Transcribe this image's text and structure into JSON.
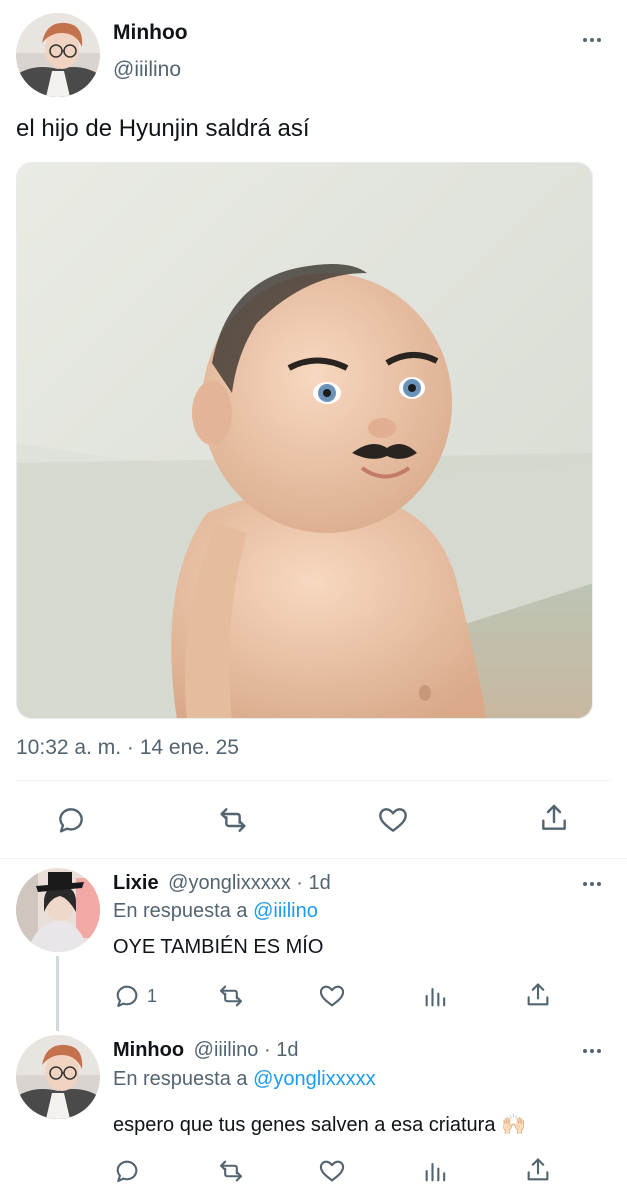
{
  "main_tweet": {
    "author_name": "Minhoo",
    "author_handle": "@iiilino",
    "text": "el hijo de Hyunjin saldrá así",
    "timestamp": "10:32 a. m. · 14 ene. 25",
    "actions": [
      "reply-icon",
      "retweet-icon",
      "like-icon",
      "share-icon"
    ]
  },
  "replies": [
    {
      "author_name": "Lixie",
      "author_handle": "@yonglixxxxx",
      "time": "· 1d",
      "reply_prefix": "En respuesta a",
      "reply_to": "@iiilino",
      "text": "OYE TAMBIÉN ES MÍO",
      "reply_count": "1"
    },
    {
      "author_name": "Minhoo",
      "author_handle": "@iiilino",
      "time": "· 1d",
      "reply_prefix": "En respuesta a",
      "reply_to": "@yonglixxxxx",
      "text": "espero que tus genes salven a esa criatura 🙌🏻",
      "reply_count": ""
    }
  ]
}
